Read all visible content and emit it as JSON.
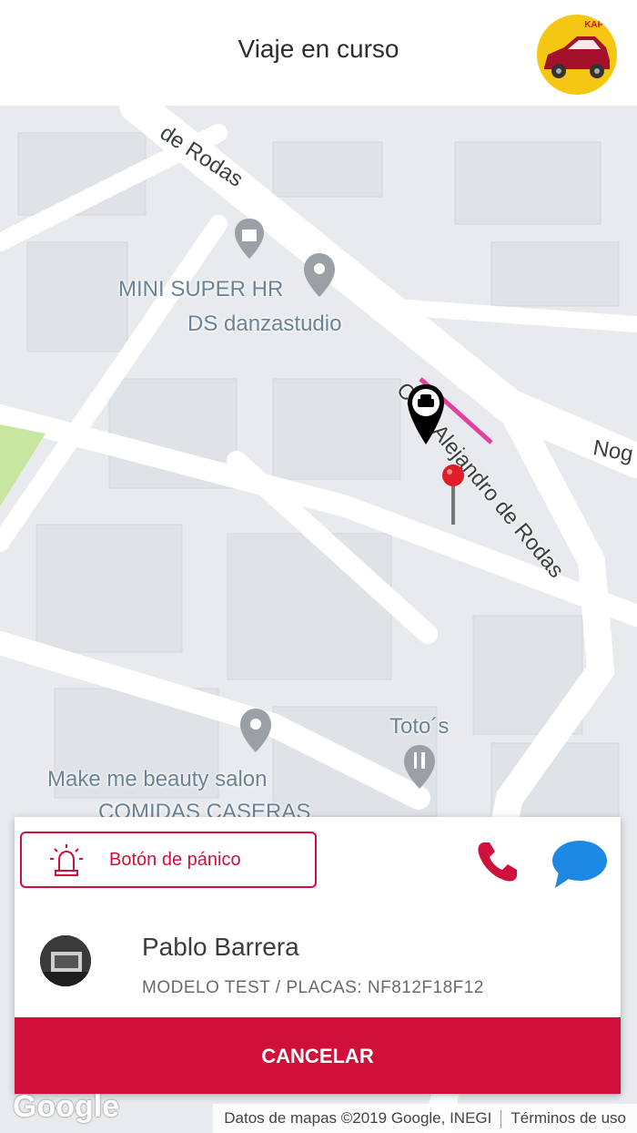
{
  "header": {
    "title": "Viaje en curso",
    "logo_text": "KAPY"
  },
  "map": {
    "pois": [
      {
        "name": "MINI SUPER HR"
      },
      {
        "name": "DS danzastudio"
      },
      {
        "name": "Toto´s"
      },
      {
        "name": "Make me beauty salon"
      },
      {
        "name": "COMIDAS CASERAS"
      }
    ],
    "streets": {
      "top": "de Rodas",
      "main": "Calle Alejandro de Rodas",
      "right": "Nog"
    },
    "route_color": "#e040a0"
  },
  "card": {
    "panic_label": "Botón de pánico",
    "driver_name": "Pablo Barrera",
    "vehicle_info": "MODELO TEST / PLACAS: NF812F18F12",
    "cancel_label": "CANCELAR"
  },
  "footer": {
    "google": "Google",
    "attribution": "Datos de mapas ©2019 Google, INEGI",
    "terms": "Términos de uso"
  },
  "colors": {
    "accent": "#d0103a",
    "chat": "#1e88e5",
    "logo_bg": "#f6c712"
  },
  "icons": [
    "siren-icon",
    "phone-icon",
    "chat-icon",
    "taxi-marker-icon",
    "destination-pin-icon",
    "shopping-bag-icon",
    "place-pin-icon",
    "restaurant-icon"
  ]
}
